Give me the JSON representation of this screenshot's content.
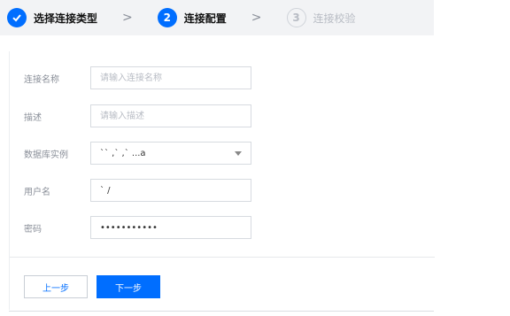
{
  "steps": [
    {
      "label": "选择连接类型",
      "state": "done",
      "icon": "check-icon"
    },
    {
      "number": "2",
      "label": "连接配置",
      "state": "active"
    },
    {
      "number": "3",
      "label": "连接校验",
      "state": "todo"
    }
  ],
  "form": {
    "name": {
      "label": "连接名称",
      "placeholder": "请输入连接名称",
      "value": ""
    },
    "desc": {
      "label": "描述",
      "placeholder": "请输入描述",
      "value": ""
    },
    "instance": {
      "label": "数据库实例",
      "value": "`` ,` ,` ...a"
    },
    "username": {
      "label": "用户名",
      "value": "` /"
    },
    "password": {
      "label": "密码",
      "value": "•••••••••••"
    }
  },
  "buttons": {
    "prev": "上一步",
    "next": "下一步"
  },
  "colors": {
    "accent": "#006eff",
    "topbar": "#f2f3f5"
  }
}
